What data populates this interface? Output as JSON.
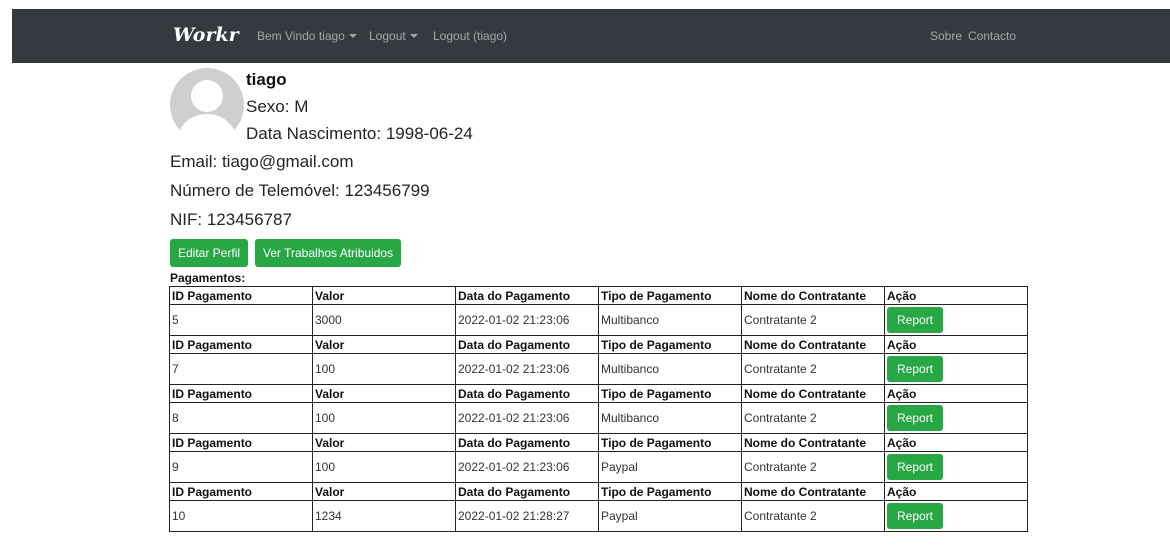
{
  "navbar": {
    "brand": "Workr",
    "welcome": "Bem Vindo tiago",
    "logout_menu": "Logout",
    "logout_user": "Logout (tiago)",
    "about": "Sobre",
    "contact": "Contacto"
  },
  "profile": {
    "username": "tiago",
    "sexo": "Sexo: M",
    "nascimento": "Data Nascimento: 1998-06-24",
    "email": "Email: tiago@gmail.com",
    "telemovel": "Número de Telemóvel: 123456799",
    "nif": "NIF: 123456787"
  },
  "buttons": {
    "edit": "Editar Perfil",
    "jobs": "Ver Trabalhos Atribuidos"
  },
  "payments": {
    "title": "Pagamentos:",
    "headers": [
      "ID Pagamento",
      "Valor",
      "Data do Pagamento",
      "Tipo de Pagamento",
      "Nome do Contratante",
      "Ação"
    ],
    "action_label": "Report",
    "rows": [
      [
        "5",
        "3000",
        "2022-01-02 21:23:06",
        "Multibanco",
        "Contratante 2"
      ],
      [
        "7",
        "100",
        "2022-01-02 21:23:06",
        "Multibanco",
        "Contratante 2"
      ],
      [
        "8",
        "100",
        "2022-01-02 21:23:06",
        "Multibanco",
        "Contratante 2"
      ],
      [
        "9",
        "100",
        "2022-01-02 21:23:06",
        "Paypal",
        "Contratante 2"
      ],
      [
        "10",
        "1234",
        "2022-01-02 21:28:27",
        "Paypal",
        "Contratante 2"
      ]
    ]
  },
  "colors": {
    "navbar": "#343a40",
    "success": "#28a745"
  }
}
